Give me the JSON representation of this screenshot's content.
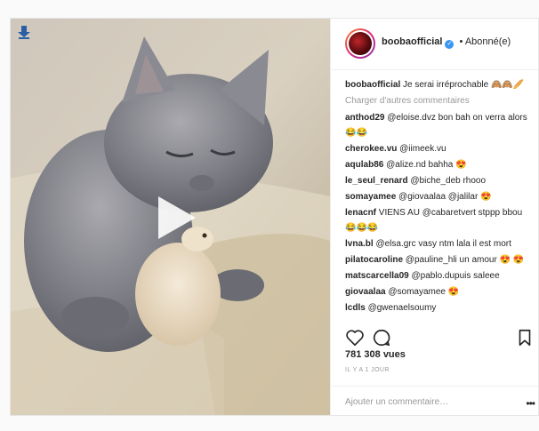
{
  "post": {
    "author": {
      "username": "boobaofficial",
      "verified_badge": "✓",
      "follow_status": "• Abonné(e)"
    },
    "caption": {
      "username": "boobaofficial",
      "text": "Je serai irréprochable 🙈🙈🥖"
    },
    "load_more_label": "Charger d'autres commentaires",
    "comments": [
      {
        "user": "anthod29",
        "text": "@eloise.dvz bon bah on verra alors 😂😂"
      },
      {
        "user": "cherokee.vu",
        "text": "@iimeek.vu"
      },
      {
        "user": "aqulab86",
        "text": "@alize.nd bahha 😍"
      },
      {
        "user": "le_seul_renard",
        "text": "@biche_deb rhooo"
      },
      {
        "user": "somayamee",
        "text": "@giovaalaa @jalilar 😍"
      },
      {
        "user": "lenacnf",
        "text": "VIENS AU @cabaretvert stppp bbou 😂😂😂"
      },
      {
        "user": "lvna.bl",
        "text": "@elsa.grc vasy ntm lala il est mort"
      },
      {
        "user": "pilatocaroline",
        "text": "@pauline_hli un amour 😍 😍"
      },
      {
        "user": "matscarcella09",
        "text": "@pablo.dupuis saleee"
      },
      {
        "user": "giovaalaa",
        "text": "@somayamee 😍"
      },
      {
        "user": "lcdls",
        "text": "@gwenaelsoumy"
      }
    ],
    "views": "781 308 vues",
    "date": "IL Y A 1 JOUR",
    "add_comment_placeholder": "Ajouter un commentaire…",
    "more_options": "•••",
    "icons": {
      "download": "download-icon",
      "play": "play-icon",
      "like": "heart-icon",
      "comment": "comment-icon",
      "save": "bookmark-icon"
    },
    "colors": {
      "verified": "#3897f0",
      "download_badge": "#2a5ea8",
      "muted_text": "#999999"
    }
  }
}
